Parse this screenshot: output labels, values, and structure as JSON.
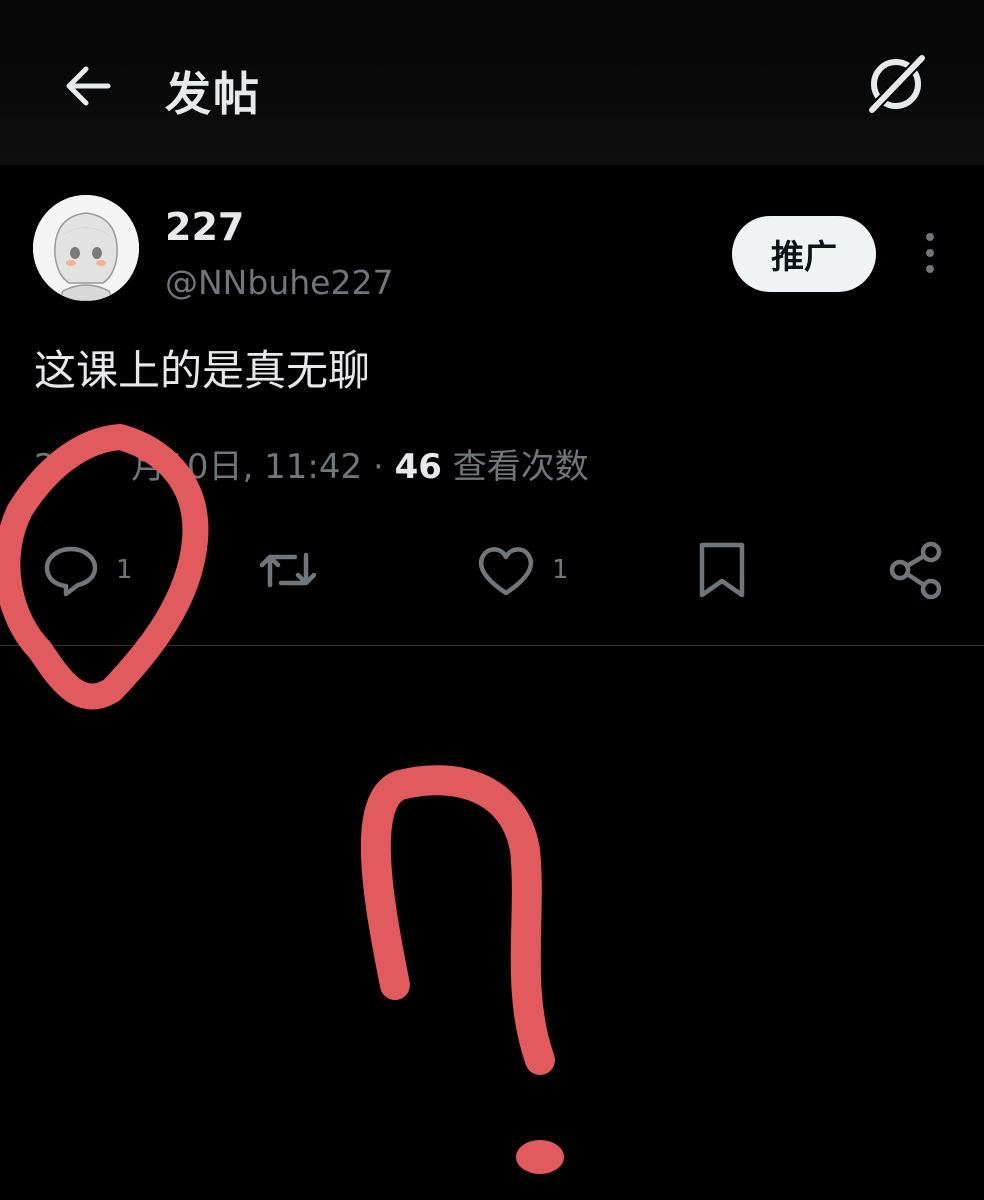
{
  "header": {
    "title": "发帖",
    "back_icon": "arrow-left-icon",
    "grok_icon": "grok-icon"
  },
  "post": {
    "display_name": "227",
    "handle": "@NNbuhe227",
    "promote_label": "推广",
    "text": "这课上的是真无聊",
    "timestamp": "2       月10日, 11:42",
    "separator": " · ",
    "views_count": "46",
    "views_label": " 查看次数"
  },
  "actions": {
    "reply_count": "1",
    "like_count": "1",
    "icons": [
      "reply-icon",
      "retweet-icon",
      "like-icon",
      "bookmark-icon",
      "share-icon"
    ]
  },
  "colors": {
    "background": "#000000",
    "primary_text": "#e7e9ea",
    "secondary_text": "#71767b",
    "annotation": "#e05a5e"
  }
}
